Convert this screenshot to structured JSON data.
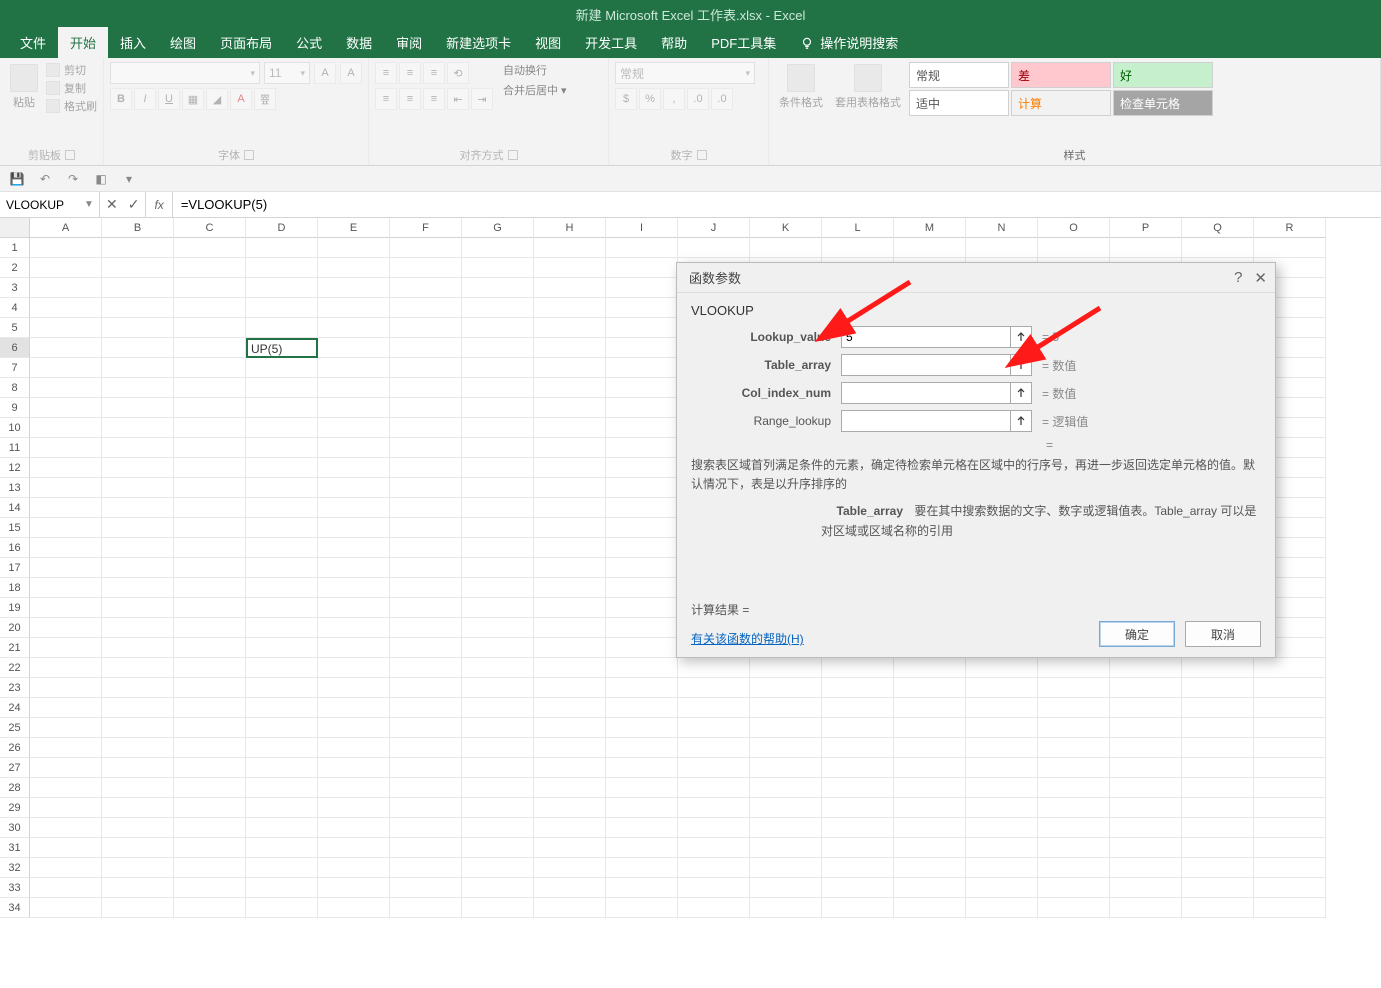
{
  "title": "新建 Microsoft Excel 工作表.xlsx  -  Excel",
  "tabs": {
    "file": "文件",
    "home": "开始",
    "insert": "插入",
    "draw": "绘图",
    "layout": "页面布局",
    "formulas": "公式",
    "data": "数据",
    "review": "审阅",
    "newtab": "新建选项卡",
    "view": "视图",
    "dev": "开发工具",
    "help": "帮助",
    "pdf": "PDF工具集",
    "tell": "操作说明搜索"
  },
  "ribbon": {
    "clipboard": {
      "paste": "粘贴",
      "cut": "剪切",
      "copy": "复制",
      "painter": "格式刷",
      "label": "剪贴板"
    },
    "font": {
      "placeholder": "",
      "size": "11",
      "label": "字体"
    },
    "align": {
      "wrap": "自动换行",
      "merge": "合并后居中",
      "label": "对齐方式"
    },
    "number": {
      "general": "常规",
      "label": "数字"
    },
    "styles": {
      "cond": "条件格式",
      "table": "套用表格格式",
      "normal": "常规",
      "neutral": "适中",
      "bad": "差",
      "calc": "计算",
      "good": "好",
      "check": "检查单元格",
      "label": "样式"
    }
  },
  "qat": {
    "save": "💾",
    "undo": "↶",
    "redo": "↷"
  },
  "formula_bar": {
    "name_box": "VLOOKUP",
    "cancel": "✕",
    "enter": "✓",
    "fx": "fx",
    "formula": "=VLOOKUP(5)"
  },
  "grid": {
    "columns": [
      "A",
      "B",
      "C",
      "D",
      "E",
      "F",
      "G",
      "H",
      "I",
      "J",
      "K",
      "L",
      "M",
      "N",
      "O",
      "P",
      "Q",
      "R"
    ],
    "rows": [
      "1",
      "2",
      "3",
      "4",
      "5",
      "6",
      "7",
      "8",
      "9",
      "10",
      "11",
      "12",
      "13",
      "14",
      "15",
      "16",
      "17",
      "18",
      "19",
      "20",
      "21",
      "22",
      "23",
      "24",
      "25",
      "26",
      "27",
      "28",
      "29",
      "30",
      "31",
      "32",
      "33",
      "34"
    ],
    "active_cell_text": "UP(5)",
    "active_row": "6"
  },
  "dialog": {
    "title": "函数参数",
    "fn": "VLOOKUP",
    "args": {
      "lookup_value": {
        "label": "Lookup_value",
        "value": "5",
        "result": "=  5"
      },
      "table_array": {
        "label": "Table_array",
        "value": "",
        "result": "=  数值"
      },
      "col_index_num": {
        "label": "Col_index_num",
        "value": "",
        "result": "=  数值"
      },
      "range_lookup": {
        "label": "Range_lookup",
        "value": "",
        "result": "=  逻辑值"
      }
    },
    "eq_only": "=",
    "desc1": "搜索表区域首列满足条件的元素，确定待检索单元格在区域中的行序号，再进一步返回选定单元格的值。默认情况下，表是以升序排序的",
    "desc2_label": "Table_array",
    "desc2_text": "要在其中搜索数据的文字、数字或逻辑值表。Table_array 可以是对区域或区域名称的引用",
    "calc": "计算结果 =",
    "help": "有关该函数的帮助(H)",
    "ok": "确定",
    "cancel": "取消"
  }
}
